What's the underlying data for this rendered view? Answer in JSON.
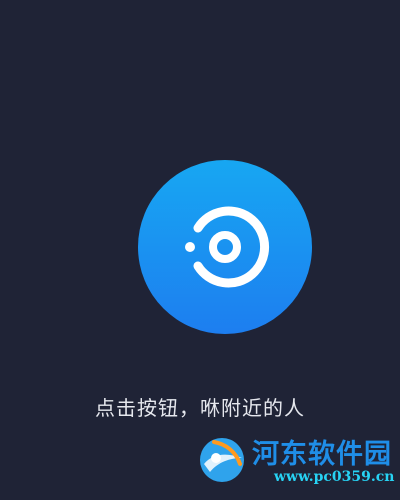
{
  "main": {
    "scan_button_icon": "radar-target-icon",
    "prompt": "点击按钮，咻附近的人"
  },
  "watermark": {
    "title": "河东软件园",
    "url": "www.pc0359.cn",
    "logo_icon": "hedong-logo-icon"
  },
  "colors": {
    "background": "#1f2336",
    "button_top": "#17a7f2",
    "button_bottom": "#1d7ef0",
    "prompt_text": "#e6e8ee",
    "watermark_blue": "#1f8ee8",
    "watermark_cyan": "#27d3f4"
  }
}
